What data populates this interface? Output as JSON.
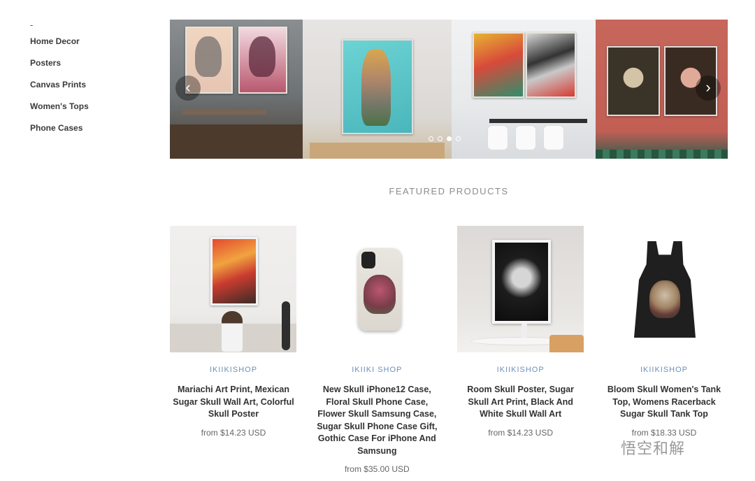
{
  "sidebar": {
    "dash": "-",
    "items": [
      {
        "label": "Home Decor"
      },
      {
        "label": "Posters"
      },
      {
        "label": "Canvas Prints"
      },
      {
        "label": "Women's Tops"
      },
      {
        "label": "Phone Cases"
      }
    ]
  },
  "slideshow": {
    "prev_icon": "chevron-left-icon",
    "next_icon": "chevron-right-icon",
    "prev_glyph": "‹",
    "next_glyph": "›",
    "slide_count": 4,
    "active_slide": 3
  },
  "featured": {
    "heading": "FEATURED PRODUCTS",
    "products": [
      {
        "vendor": "IKIIKISHOP",
        "title": "Mariachi Art Print, Mexican Sugar Skull Wall Art, Colorful Skull Poster",
        "price": "from $14.23 USD"
      },
      {
        "vendor": "IKIIKI SHOP",
        "title": "New Skull iPhone12 Case, Floral Skull Phone Case, Flower Skull Samsung Case, Sugar Skull Phone Case Gift, Gothic Case For iPhone And Samsung",
        "price": "from $35.00 USD"
      },
      {
        "vendor": "IKIIKISHOP",
        "title": "Room Skull Poster, Sugar Skull Art Print, Black And White Skull Wall Art",
        "price": "from $14.23 USD"
      },
      {
        "vendor": "IKIIKISHOP",
        "title": "Bloom Skull Women's Tank Top, Womens Racerback Sugar Skull Tank Top",
        "price": "from $18.33 USD"
      }
    ]
  },
  "watermark": {
    "text": "悟空和解"
  },
  "colors": {
    "vendor": "#6b8fb8",
    "heading": "#8c8c8c"
  }
}
